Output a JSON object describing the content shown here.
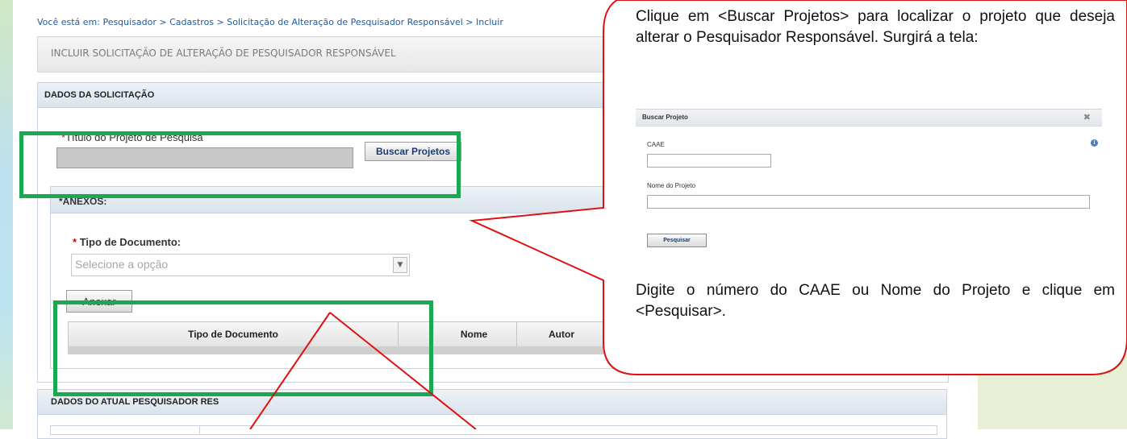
{
  "breadcrumb": "Você está em: Pesquisador > Cadastros > Solicitação de Alteração de Pesquisador Responsável > Incluir",
  "page_title": "INCLUIR SOLICITAÇÃO DE ALTERAÇÃO DE PESQUISADOR RESPONSÁVEL",
  "sections": {
    "dados_solicitacao": "DADOS DA SOLICITAÇÃO",
    "dados_atual_pesquisador": "DADOS DO ATUAL PESQUISADOR RES"
  },
  "form": {
    "titulo_label": "Título do Projeto de Pesquisa",
    "buscar_button": "Buscar Projetos",
    "anexos_label": "*ANEXOS:",
    "required_mark": "*",
    "tipo_documento_label": "Tipo de Documento:",
    "tipo_documento_placeholder": "Selecione a opção",
    "anexar_button": "Anexar"
  },
  "table": {
    "columns": [
      "Tipo de Documento",
      "Nome",
      "Autor"
    ]
  },
  "callout": {
    "text_top": "Clique em <Buscar Projetos> para localizar o projeto que deseja alterar o Pesquisador Responsável. Surgirá a tela:",
    "text_bottom": "Digite o número do CAAE ou Nome do Projeto e clique em <Pesquisar>."
  },
  "dialog": {
    "title": "Buscar Projeto",
    "caae_label": "CAAE",
    "nome_label": "Nome do Projeto",
    "pesquisar_button": "Pesquisar",
    "close_icon": "close-icon",
    "info_icon": "info-icon"
  },
  "colors": {
    "highlight_green": "#1aa851",
    "callout_red": "#e01010",
    "link_blue": "#1f5aa5"
  }
}
